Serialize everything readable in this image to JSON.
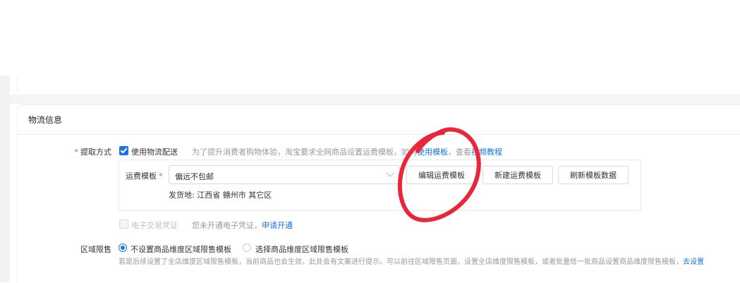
{
  "section": {
    "title": "物流信息"
  },
  "pickup": {
    "label": "提取方式",
    "use_logistics_label": "使用物流配送",
    "hint_prefix": "为了提升消费者购物体验，淘宝要求全网商品设置运费模板，如何",
    "hint_link1": "使用模板",
    "hint_mid": "，查看",
    "hint_link2": "视频教程",
    "freight_template_label": "运费模板",
    "freight_template_value": "偏远不包邮",
    "edit_button": "编辑运费模板",
    "new_button": "新建运费模板",
    "refresh_button": "刷新模板数据",
    "ship_from": "发货地: 江西省 赣州市 其它区",
    "e_voucher_label": "电子交易凭证",
    "e_voucher_status": "您未开通电子凭证，",
    "e_voucher_link": "申请开通"
  },
  "region_limit": {
    "label": "区域限售",
    "option_none": "不设置商品维度区域限售模板",
    "option_select": "选择商品维度区域限售模板",
    "hint": "若是后续设置了全店维度区域限售模板，当前商品也会生效，此处会有文案进行提示。可以前往区域限售页面，设置全店维度限售模板，或者批量给一批商品设置商品维度限售模板，",
    "hint_link": "去设置"
  },
  "annotation": {
    "color": "#e8283a"
  }
}
